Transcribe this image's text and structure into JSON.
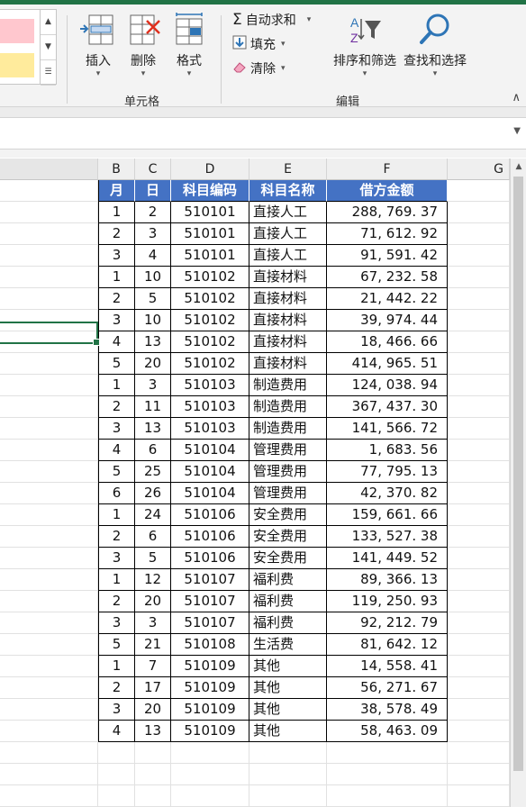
{
  "ribbon": {
    "insert_label": "插入",
    "delete_label": "删除",
    "format_label": "格式",
    "cells_group_label": "单元格",
    "autosum_label": "自动求和",
    "fill_label": "填充",
    "clear_label": "清除",
    "sort_filter_label": "排序和筛选",
    "find_select_label": "查找和选择",
    "editing_group_label": "编辑",
    "sigma_glyph": "Σ",
    "dropdown_glyph": "▾",
    "collapse_glyph": "∧"
  },
  "columns": [
    "B",
    "C",
    "D",
    "E",
    "F",
    "G"
  ],
  "table": {
    "headers": [
      "月",
      "日",
      "科目编码",
      "科目名称",
      "借方金额"
    ],
    "rows": [
      [
        "1",
        "2",
        "510101",
        "直接人工",
        "288, 769. 37"
      ],
      [
        "2",
        "3",
        "510101",
        "直接人工",
        "71, 612. 92"
      ],
      [
        "3",
        "4",
        "510101",
        "直接人工",
        "91, 591. 42"
      ],
      [
        "1",
        "10",
        "510102",
        "直接材料",
        "67, 232. 58"
      ],
      [
        "2",
        "5",
        "510102",
        "直接材料",
        "21, 442. 22"
      ],
      [
        "3",
        "10",
        "510102",
        "直接材料",
        "39, 974. 44"
      ],
      [
        "4",
        "13",
        "510102",
        "直接材料",
        "18, 466. 66"
      ],
      [
        "5",
        "20",
        "510102",
        "直接材料",
        "414, 965. 51"
      ],
      [
        "1",
        "3",
        "510103",
        "制造费用",
        "124, 038. 94"
      ],
      [
        "2",
        "11",
        "510103",
        "制造费用",
        "367, 437. 30"
      ],
      [
        "3",
        "13",
        "510103",
        "制造费用",
        "141, 566. 72"
      ],
      [
        "4",
        "6",
        "510104",
        "管理费用",
        "1, 683. 56"
      ],
      [
        "5",
        "25",
        "510104",
        "管理费用",
        "77, 795. 13"
      ],
      [
        "6",
        "26",
        "510104",
        "管理费用",
        "42, 370. 82"
      ],
      [
        "1",
        "24",
        "510106",
        "安全费用",
        "159, 661. 66"
      ],
      [
        "2",
        "6",
        "510106",
        "安全费用",
        "133, 527. 38"
      ],
      [
        "3",
        "5",
        "510106",
        "安全费用",
        "141, 449. 52"
      ],
      [
        "1",
        "12",
        "510107",
        "福利费",
        "89, 366. 13"
      ],
      [
        "2",
        "20",
        "510107",
        "福利费",
        "119, 250. 93"
      ],
      [
        "3",
        "3",
        "510107",
        "福利费",
        "92, 212. 79"
      ],
      [
        "5",
        "21",
        "510108",
        "生活费",
        "81, 642. 12"
      ],
      [
        "1",
        "7",
        "510109",
        "其他",
        "14, 558. 41"
      ],
      [
        "2",
        "17",
        "510109",
        "其他",
        "56, 271. 67"
      ],
      [
        "3",
        "20",
        "510109",
        "其他",
        "38, 578. 49"
      ],
      [
        "4",
        "13",
        "510109",
        "其他",
        "58, 463. 09"
      ]
    ]
  },
  "colors": {
    "accent": "#217346",
    "table_header_bg": "#4472c4",
    "bad_style": "#ffc7ce",
    "neutral_style": "#ffeb9c"
  },
  "icons": [
    "insert-cells-icon",
    "delete-cells-icon",
    "format-cells-icon",
    "autosum-icon",
    "fill-down-icon",
    "eraser-icon",
    "sort-filter-icon",
    "find-magnifier-icon"
  ]
}
